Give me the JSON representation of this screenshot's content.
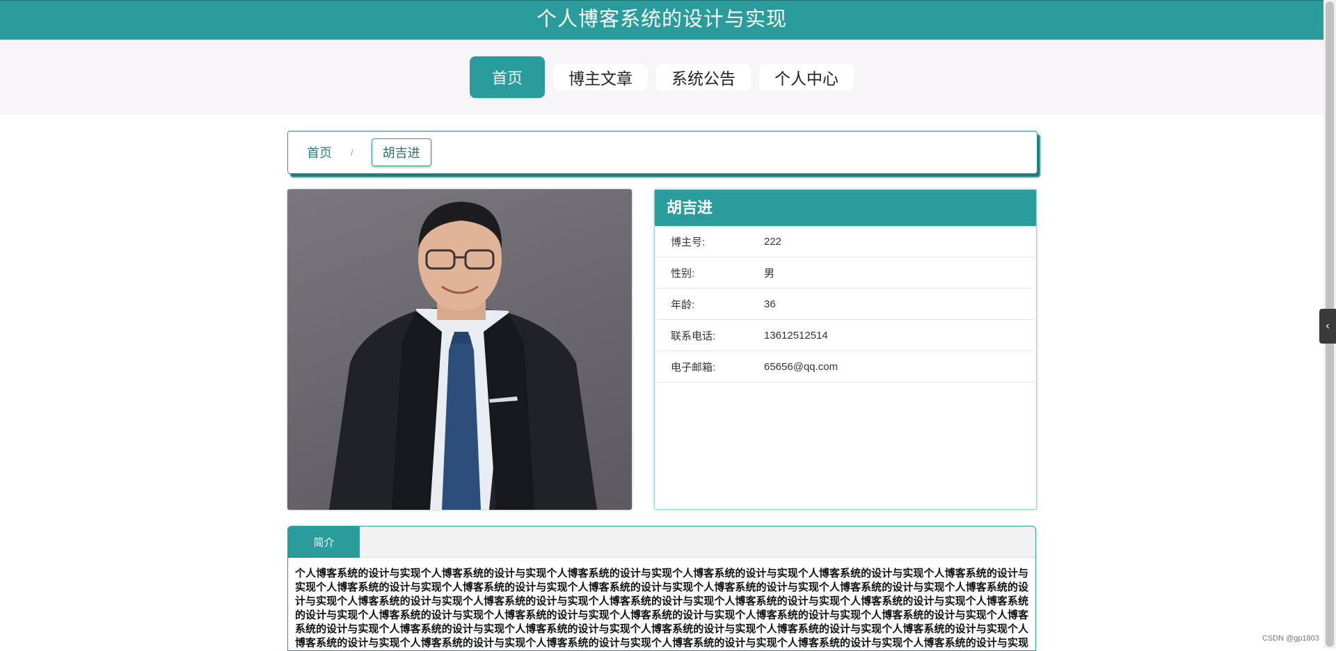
{
  "header": {
    "title": "个人博客系统的设计与实现"
  },
  "nav": {
    "items": [
      {
        "label": "首页"
      },
      {
        "label": "博主文章"
      },
      {
        "label": "系统公告"
      },
      {
        "label": "个人中心"
      }
    ]
  },
  "breadcrumb": {
    "home": "首页",
    "separator": "/",
    "current": "胡吉进"
  },
  "profile": {
    "name": "胡吉进",
    "fields": [
      {
        "label": "博主号:",
        "value": "222"
      },
      {
        "label": "性别:",
        "value": "男"
      },
      {
        "label": "年龄:",
        "value": "36"
      },
      {
        "label": "联系电话:",
        "value": "13612512514"
      },
      {
        "label": "电子邮箱:",
        "value": "65656@qq.com"
      }
    ]
  },
  "tabs": {
    "active_label": "简介",
    "content": "个人博客系统的设计与实现个人博客系统的设计与实现个人博客系统的设计与实现个人博客系统的设计与实现个人博客系统的设计与实现个人博客系统的设计与实现个人博客系统的设计与实现个人博客系统的设计与实现个人博客系统的设计与实现个人博客系统的设计与实现个人博客系统的设计与实现个人博客系统的设计与实现个人博客系统的设计与实现个人博客系统的设计与实现个人博客系统的设计与实现个人博客系统的设计与实现个人博客系统的设计与实现个人博客系统的设计与实现个人博客系统的设计与实现个人博客系统的设计与实现个人博客系统的设计与实现个人博客系统的设计与实现个人博客系统的设计与实现个人博客系统的设计与实现个人博客系统的设计与实现个人博客系统的设计与实现个人博客系统的设计与实现个人博客系统的设计与实现个人博客系统的设计与实现个人博客系统的设计与实现个人博客系统的设计与实现个人博客系统的设计与实现个人博客系统的设计与实现个人博客系统的设计与实现个人博客系统的设计与实现个人博客系统的设计与实现个人博客系统的设计与实现个人博客系统的设计与实现个人博客系统的设计与实现个人博客系统的设计与实现个人博客系统的设计与实现个人博客系统的设计与实现个人博客系统的设计与实现"
  },
  "side_toggle": {
    "icon": "chevron-left-icon",
    "glyph": "‹"
  },
  "watermark": "CSDN @gp1803",
  "colors": {
    "accent": "#2a9c9c",
    "nav_band": "#f7f5f8"
  }
}
